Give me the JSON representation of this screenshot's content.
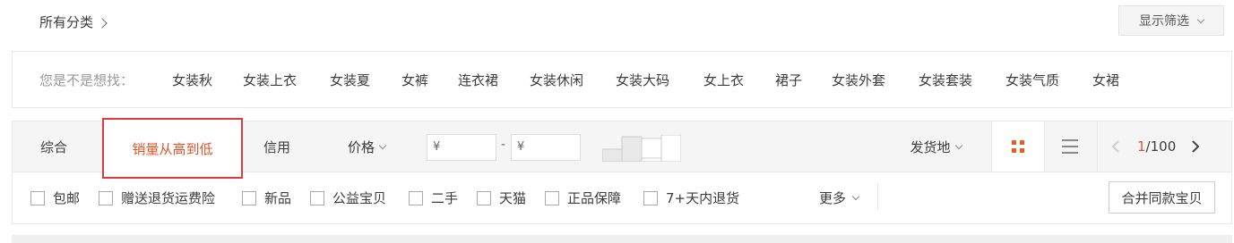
{
  "breadcrumb": {
    "label": "所有分类"
  },
  "filter_toggle": {
    "label": "显示筛选"
  },
  "suggest": {
    "label": "您是不是想找：",
    "items": [
      "女装秋",
      "女装上衣",
      "女装夏",
      "女裤",
      "连衣裙",
      "女装休闲",
      "女装大码",
      "女上衣",
      "裙子",
      "女装外套",
      "女装套装",
      "女装气质",
      "女裙"
    ]
  },
  "sort": {
    "tabs": [
      "综合",
      "销量从高到低",
      "信用",
      "价格"
    ],
    "active": "销量从高到低",
    "price_min_placeholder": "¥",
    "price_max_placeholder": "¥",
    "price_sep": "-",
    "ship_from": "发货地"
  },
  "pager": {
    "current": "1",
    "total": "/100"
  },
  "options": {
    "items": [
      "包邮",
      "赠送退货运费险",
      "新品",
      "公益宝贝",
      "二手",
      "天猫",
      "正品保障",
      "7+天内退货"
    ],
    "more": "更多",
    "merge_button": "合并同款宝贝"
  },
  "colors": {
    "accent": "#e0542a",
    "highlight_border": "#e03a3a",
    "grid_icon": "#f05a1a"
  }
}
